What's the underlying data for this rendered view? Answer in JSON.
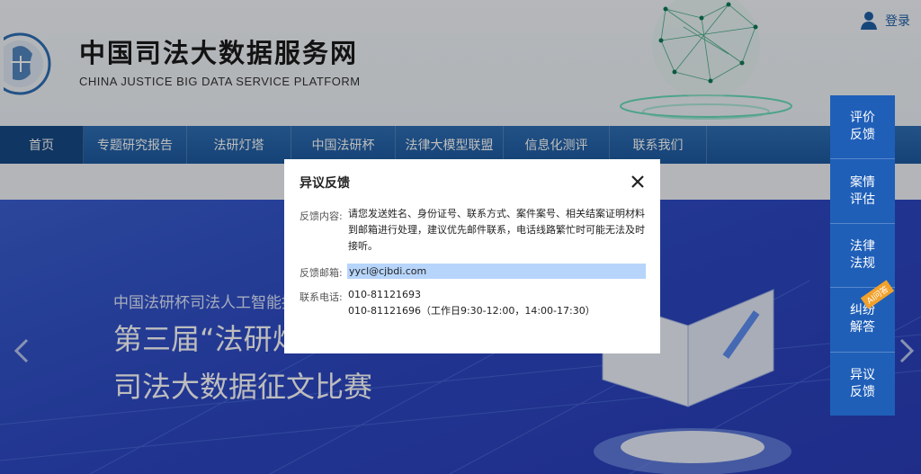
{
  "header": {
    "title": "中国司法大数据服务网",
    "subtitle": "CHINA JUSTICE BIG DATA SERVICE PLATFORM",
    "login_label": "登录"
  },
  "nav": {
    "items": [
      {
        "label": "首页",
        "active": true
      },
      {
        "label": "专题研究报告"
      },
      {
        "label": "法研灯塔"
      },
      {
        "label": "中国法研杯"
      },
      {
        "label": "法律大模型联盟"
      },
      {
        "label": "信息化测评"
      },
      {
        "label": "联系我们"
      }
    ]
  },
  "banner": {
    "line1": "中国法研杯司法人工智能挑",
    "line2": "第三届“法研灯塔",
    "line3": "司法大数据征文比赛"
  },
  "sidebar": {
    "items": [
      {
        "label": "评价反馈"
      },
      {
        "label": "案情评估"
      },
      {
        "label": "法律法规"
      },
      {
        "label": "纠纷解答",
        "badge": "AI问答"
      },
      {
        "label": "异议反馈"
      }
    ]
  },
  "modal": {
    "title": "异议反馈",
    "content_label": "反馈内容:",
    "content_lines": [
      "请您发送姓名、身份证号、联系方式、案件案号、相关结案证明材料",
      "到邮箱进行处理，建议优先邮件联系，电话线路繁忙时可能无法及时",
      "接听。"
    ],
    "email_label": "反馈邮箱:",
    "email_value": "yycl@cjbdi.com",
    "phone_label": "联系电话:",
    "phone_lines": [
      "010-81121693",
      "010-81121696（工作日9:30-12:00，14:00-17:30）"
    ]
  },
  "colors": {
    "nav": "#1d5aa0",
    "nav_active": "#164a86",
    "sidebar": "#1f5fb8",
    "banner": "#2d49c4",
    "email_highlight": "#b7d5fb",
    "badge": "#f2a12b"
  }
}
